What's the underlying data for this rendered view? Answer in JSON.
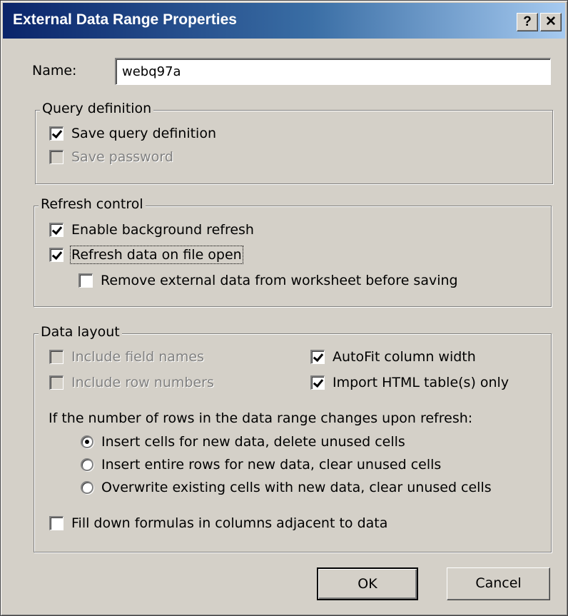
{
  "window": {
    "title": "External Data Range Properties",
    "help_button": "?",
    "close_button": "✕"
  },
  "name_field": {
    "label": "Name:",
    "value": "webq97a"
  },
  "query_definition": {
    "title": "Query definition",
    "save_query_definition": {
      "label": "Save query definition",
      "checked": true,
      "enabled": true
    },
    "save_password": {
      "label": "Save password",
      "checked": false,
      "enabled": false
    }
  },
  "refresh_control": {
    "title": "Refresh control",
    "enable_background_refresh": {
      "label": "Enable background refresh",
      "checked": true,
      "enabled": true
    },
    "refresh_on_open": {
      "label": "Refresh data on file open",
      "checked": true,
      "enabled": true
    },
    "remove_external_data": {
      "label": "Remove external data from worksheet before saving",
      "checked": false,
      "enabled": true
    }
  },
  "data_layout": {
    "title": "Data layout",
    "include_field_names": {
      "label": "Include field names",
      "checked": false,
      "enabled": false
    },
    "include_row_numbers": {
      "label": "Include row numbers",
      "checked": false,
      "enabled": false
    },
    "autofit_column_width": {
      "label": "AutoFit column width",
      "checked": true,
      "enabled": true
    },
    "import_html_tables_only": {
      "label": "Import HTML table(s) only",
      "checked": true,
      "enabled": true
    },
    "rows_change_prompt": "If the number of rows in the data range changes upon refresh:",
    "radio_options": [
      {
        "label": "Insert cells for new data, delete unused cells",
        "selected": true
      },
      {
        "label": "Insert entire rows for new data, clear unused cells",
        "selected": false
      },
      {
        "label": "Overwrite existing cells with new data, clear unused cells",
        "selected": false
      }
    ],
    "fill_down_formulas": {
      "label": "Fill down formulas in columns adjacent to data",
      "checked": false,
      "enabled": true
    }
  },
  "buttons": {
    "ok": "OK",
    "cancel": "Cancel"
  },
  "colors": {
    "dialog_face": "#d4d0c8",
    "title_gradient_start": "#0a246a",
    "title_gradient_end": "#a6caf0",
    "disabled_text": "#808080"
  }
}
